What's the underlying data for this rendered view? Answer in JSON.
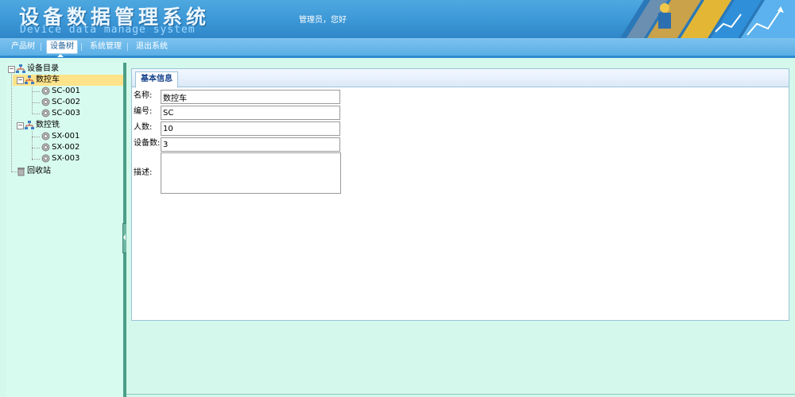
{
  "header": {
    "title": "设备数据管理系统",
    "subtitle": "Device data manage system",
    "welcome": "管理员，您好"
  },
  "nav": {
    "tabs": [
      {
        "label": "产品树"
      },
      {
        "label": "设备树"
      },
      {
        "label": "系统管理"
      },
      {
        "label": "退出系统"
      }
    ],
    "active_index": 1
  },
  "tree": {
    "root": "设备目录",
    "groups": [
      {
        "label": "数控车",
        "items": [
          "SC-001",
          "SC-002",
          "SC-003"
        ]
      },
      {
        "label": "数控铣",
        "items": [
          "SX-001",
          "SX-002",
          "SX-003"
        ]
      }
    ],
    "recycle": "回收站",
    "selected": "数控车"
  },
  "panel": {
    "tab": "基本信息",
    "fields": [
      {
        "label": "名称:",
        "value": "数控车"
      },
      {
        "label": "编号:",
        "value": "SC"
      },
      {
        "label": "人数:",
        "value": "10"
      },
      {
        "label": "设备数:",
        "value": "3"
      }
    ],
    "description_label": "描述:",
    "description_value": ""
  },
  "colors": {
    "header_blue": "#3b97d6",
    "nav_blue": "#5aafe6",
    "sidebar_bg": "#d8fbef",
    "selected_bg": "#ffe38a",
    "tab_text": "#15428b"
  }
}
